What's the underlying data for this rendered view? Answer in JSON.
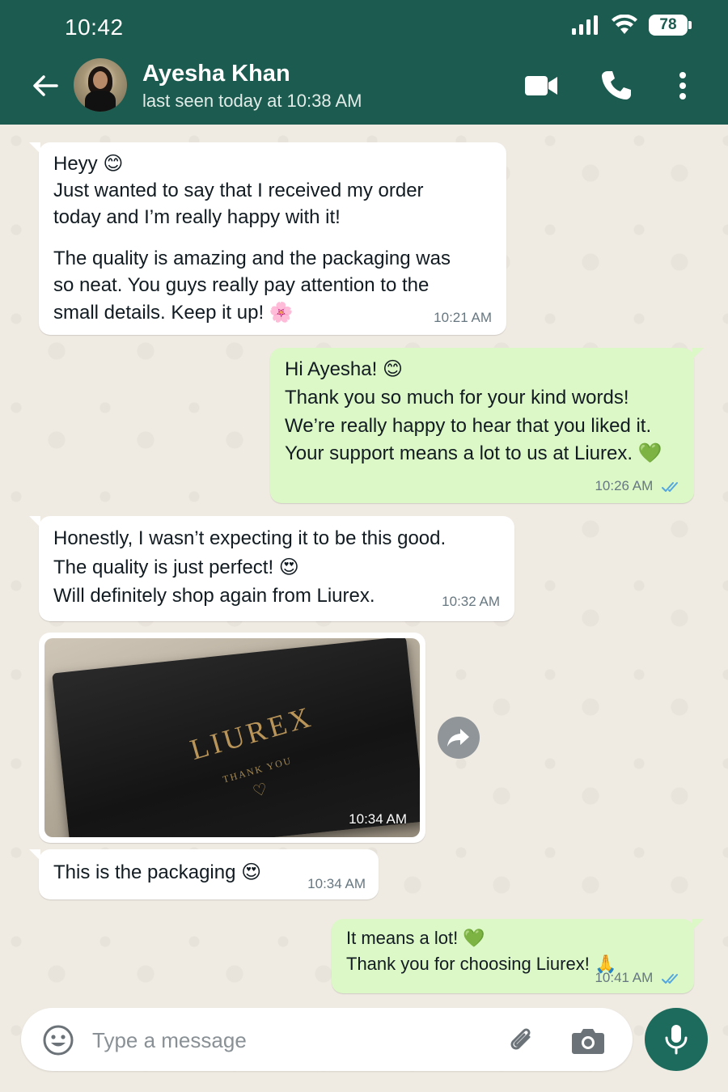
{
  "status_bar": {
    "time": "10:42",
    "battery": "78"
  },
  "header": {
    "name": "Ayesha Khan",
    "last_seen": "last seen today at 10:38 AM"
  },
  "messages": [
    {
      "dir": "in",
      "lines": [
        "Heyy 😊",
        "Just wanted to say that I received my order",
        "today and I’m really happy with it!",
        "The quality is amazing and the packaging was",
        "so neat. You guys really pay attention to the",
        "small details. Keep it up! 🌸"
      ],
      "time": "10:21 AM"
    },
    {
      "dir": "out",
      "lines": [
        "Hi Ayesha! 😊",
        "Thank you so much for your kind words!",
        "We’re really happy to hear that you liked it.",
        "Your support means a lot to us at Liurex. 💚"
      ],
      "time": "10:26 AM"
    },
    {
      "dir": "in",
      "lines": [
        "Honestly, I wasn’t expecting it to be this good.",
        "The quality is just perfect! 😍",
        "Will definitely shop again from Liurex."
      ],
      "time": "10:32 AM"
    },
    {
      "dir": "in",
      "type": "image",
      "image_text": {
        "brand": "LIUREX",
        "sub": "THANK YOU",
        "heart": "♡"
      },
      "time": "10:34 AM"
    },
    {
      "dir": "in",
      "lines": [
        "This is the packaging 😍"
      ],
      "time": "10:34 AM"
    },
    {
      "dir": "out",
      "lines": [
        "It means a lot! 💚",
        "Thank you for choosing Liurex! 🙏"
      ],
      "time": "10:41 AM"
    }
  ],
  "composer": {
    "placeholder": "Type a message"
  },
  "colors": {
    "header": "#1c5b4f",
    "outgoing": "#dcf8c6",
    "incoming": "#ffffff",
    "mic_button": "#1c6b5c",
    "read_ticks": "#53a6e0"
  },
  "icons": [
    "back-arrow-icon",
    "video-call-icon",
    "phone-icon",
    "more-options-icon",
    "forward-icon",
    "emoji-icon",
    "attach-icon",
    "camera-icon",
    "mic-icon",
    "signal-icon",
    "wifi-icon",
    "battery-icon",
    "read-ticks-icon"
  ]
}
